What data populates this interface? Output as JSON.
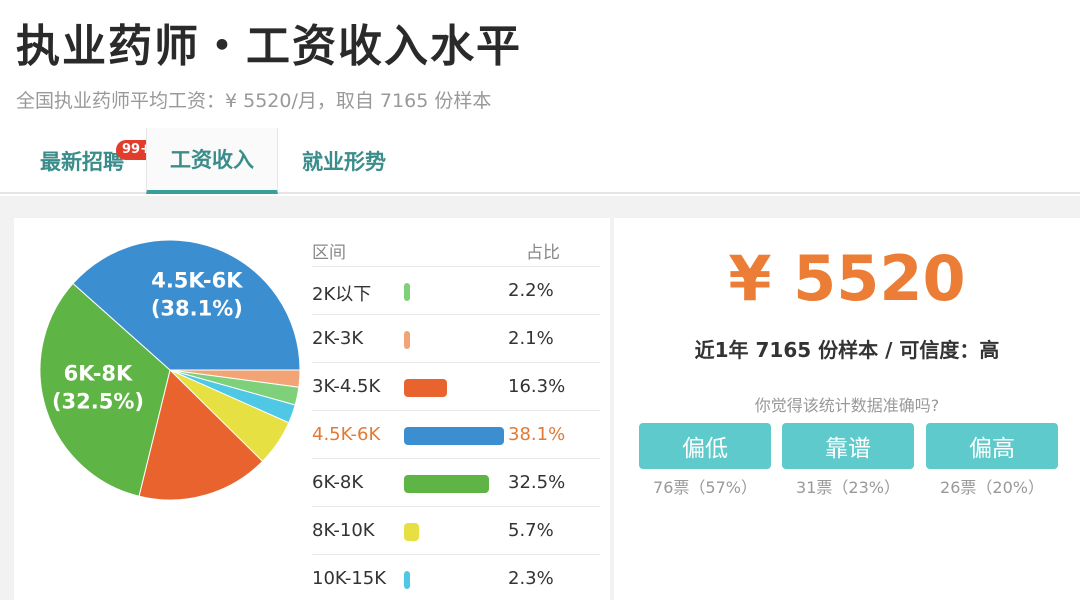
{
  "header": {
    "title": "执业药师・工资收入水平",
    "subtitle": "全国执业药师平均工资：¥ 5520/月，取自 7165 份样本"
  },
  "tabs": [
    {
      "label": "最新招聘",
      "badge": "99+"
    },
    {
      "label": "工资收入"
    },
    {
      "label": "就业形势"
    }
  ],
  "colors": {
    "accent": "#3a9e9a",
    "salary": "#ec7d36",
    "vote_button": "#5ecacb",
    "badge": "#e23c2c"
  },
  "chart_data": {
    "type": "pie",
    "categories": [
      "2K以下",
      "2K-3K",
      "3K-4.5K",
      "4.5K-6K",
      "6K-8K",
      "8K-10K",
      "10K-15K"
    ],
    "values": [
      2.2,
      2.1,
      16.3,
      38.1,
      32.5,
      5.7,
      2.3
    ],
    "colors": [
      "#7ed07b",
      "#f2a477",
      "#e9632f",
      "#3b8ed0",
      "#5fb446",
      "#e6e043",
      "#4fc8e6"
    ],
    "slice_labels": [
      {
        "index": 3,
        "name": "4.5K-6K",
        "pct": "(38.1%)"
      },
      {
        "index": 4,
        "name": "6K-8K",
        "pct": "(32.5%)"
      }
    ]
  },
  "table": {
    "col_range": "区间",
    "col_pct": "占比",
    "highlight_index": 3,
    "rows": [
      {
        "range": "2K以下",
        "pct": "2.2%"
      },
      {
        "range": "2K-3K",
        "pct": "2.1%"
      },
      {
        "range": "3K-4.5K",
        "pct": "16.3%"
      },
      {
        "range": "4.5K-6K",
        "pct": "38.1%"
      },
      {
        "range": "6K-8K",
        "pct": "32.5%"
      },
      {
        "range": "8K-10K",
        "pct": "5.7%"
      },
      {
        "range": "10K-15K",
        "pct": "2.3%"
      }
    ]
  },
  "summary": {
    "salary": "¥ 5520",
    "sample_text": "近1年 7165 份样本 / 可信度：高",
    "question": "你觉得该统计数据准确吗?",
    "votes": [
      {
        "label": "偏低",
        "count": "76票（57%）"
      },
      {
        "label": "靠谱",
        "count": "31票（23%）"
      },
      {
        "label": "偏高",
        "count": "26票（20%）"
      }
    ]
  }
}
